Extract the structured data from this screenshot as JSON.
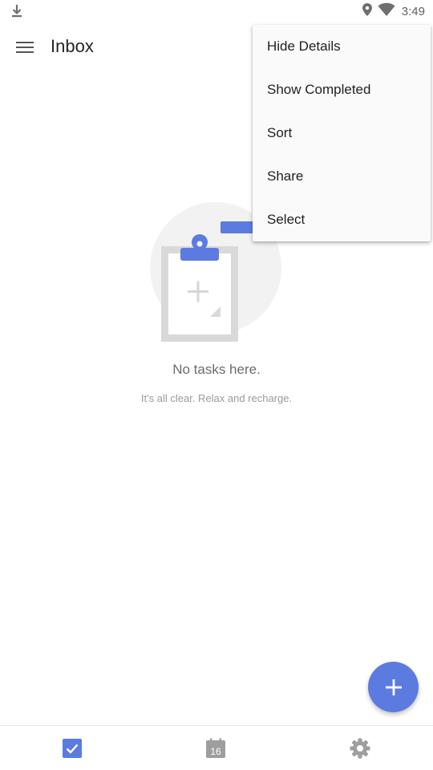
{
  "status_bar": {
    "time": "3:49",
    "icons": [
      "download-icon",
      "location-icon",
      "wifi-icon"
    ]
  },
  "app_bar": {
    "title": "Inbox",
    "menu_icon": "hamburger-menu-icon"
  },
  "overflow_menu": {
    "items": [
      {
        "label": "Hide Details"
      },
      {
        "label": "Show Completed"
      },
      {
        "label": "Sort"
      },
      {
        "label": "Share"
      },
      {
        "label": "Select"
      }
    ]
  },
  "empty_state": {
    "title": "No tasks here.",
    "subtitle": "It's all clear. Relax and recharge.",
    "illustration": "clipboard-icon"
  },
  "fab": {
    "icon": "plus-icon"
  },
  "bottom_nav": {
    "items": [
      {
        "icon": "tasks-checkbox-icon",
        "active": true
      },
      {
        "icon": "calendar-icon",
        "label": "16",
        "active": false
      },
      {
        "icon": "settings-gear-icon",
        "active": false
      }
    ]
  },
  "colors": {
    "accent": "#5c7be0",
    "text_primary": "#262626",
    "text_secondary": "#6b6b6b",
    "text_tertiary": "#9a9a9a",
    "icon_gray": "#9e9e9e",
    "illustration_circle": "#f2f2f2",
    "illustration_board": "#dcdcdc"
  }
}
